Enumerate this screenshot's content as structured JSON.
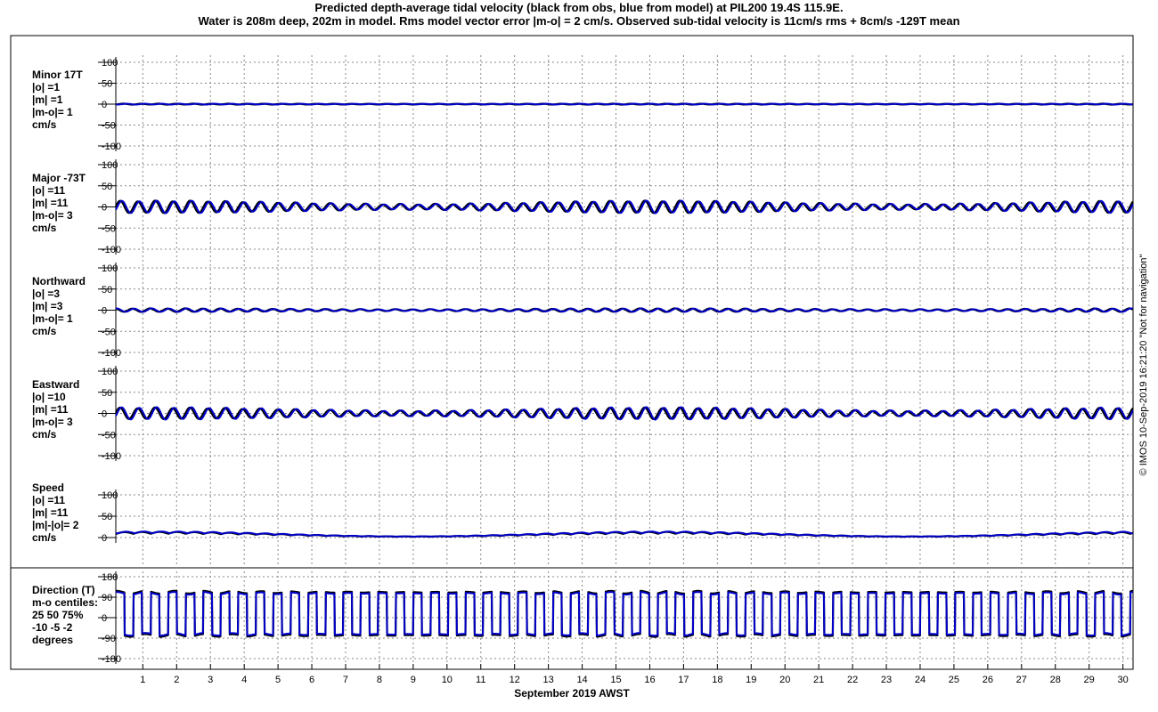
{
  "title": {
    "line1": "Predicted depth-average tidal velocity (black from obs, blue from model) at PIL200 19.4S 115.9E.",
    "line2": "Water is 208m deep, 202m in model. Rms model vector error |m-o| = 2 cm/s. Observed sub-tidal velocity is 11cm/s rms + 8cm/s -129T mean"
  },
  "colors": {
    "obs": "#000000",
    "model": "#0000cc",
    "grid": "#888888"
  },
  "chart_data": {
    "type": "line",
    "xlabel": "September 2019 AWST",
    "xticks": [
      "1",
      "2",
      "3",
      "4",
      "5",
      "6",
      "7",
      "8",
      "9",
      "10",
      "11",
      "12",
      "13",
      "14",
      "15",
      "16",
      "17",
      "18",
      "19",
      "20",
      "21",
      "22",
      "23",
      "24",
      "25",
      "26",
      "27",
      "28",
      "29",
      "30"
    ],
    "xlim_days": [
      0.2,
      30.3
    ],
    "grid": true,
    "footer": "© IMOS 10-Sep-2019 16:21:20  \"Not for navigation\"",
    "panels": [
      {
        "key": "minor",
        "label_lines": [
          "Minor 17T",
          "|o| =1",
          "|m| =1",
          "|m-o|= 1",
          "cm/s"
        ],
        "yticks": [
          "100",
          "50",
          "0",
          "-50",
          "-100"
        ],
        "ylim": [
          -100,
          100
        ],
        "series": [
          {
            "amp": 1,
            "spring": 0.8,
            "phase": 0.3,
            "envelope": 0.3
          },
          {
            "amp": 1,
            "spring": 0.8,
            "phase": 0.4,
            "envelope": 0.3
          }
        ]
      },
      {
        "key": "major",
        "label_lines": [
          "Major -73T",
          "|o| =11",
          "|m| =11",
          "|m-o|= 3",
          "cm/s"
        ],
        "yticks": [
          "100",
          "50",
          "0",
          "-50",
          "-100"
        ],
        "ylim": [
          -100,
          100
        ],
        "series": [
          {
            "amp": 14,
            "spring": 7,
            "phase": 0.2,
            "envelope": 0.55
          },
          {
            "amp": 14,
            "spring": 7,
            "phase": 0.25,
            "envelope": 0.55
          }
        ]
      },
      {
        "key": "north",
        "label_lines": [
          "Northward",
          "|o| =3",
          "|m| =3",
          "|m-o|= 1",
          "cm/s"
        ],
        "yticks": [
          "100",
          "50",
          "0",
          "-50",
          "-100"
        ],
        "ylim": [
          -100,
          100
        ],
        "series": [
          {
            "amp": 4,
            "spring": 2,
            "phase": 1.6,
            "envelope": 0.5
          },
          {
            "amp": 4,
            "spring": 2,
            "phase": 1.65,
            "envelope": 0.5
          }
        ]
      },
      {
        "key": "east",
        "label_lines": [
          "Eastward",
          "|o| =10",
          "|m| =11",
          "|m-o|= 3",
          "cm/s"
        ],
        "yticks": [
          "100",
          "50",
          "0",
          "-50",
          "-100"
        ],
        "ylim": [
          -100,
          100
        ],
        "series": [
          {
            "amp": 13,
            "spring": 7,
            "phase": 3.3,
            "envelope": 0.55
          },
          {
            "amp": 14,
            "spring": 7,
            "phase": 3.35,
            "envelope": 0.55
          }
        ]
      },
      {
        "key": "speed",
        "label_lines": [
          "Speed",
          "|o| =11",
          "|m| =11",
          "|m|-|o|= 2",
          "cm/s"
        ],
        "yticks": [
          "100",
          "50",
          "0"
        ],
        "ylim": [
          0,
          100
        ],
        "series": [
          {
            "base": 9,
            "amp": 7,
            "phase": 0.2
          },
          {
            "base": 10,
            "amp": 7,
            "phase": 0.25
          }
        ]
      },
      {
        "key": "direction",
        "label_lines": [
          "Direction (T)",
          "m-o centiles:",
          "25  50  75%",
          "-10  -5  -2",
          "degrees"
        ],
        "yticks": [
          "180",
          "90",
          "0",
          "-90",
          "-180"
        ],
        "ylim": [
          -180,
          180
        ],
        "series": [
          {
            "high": 107,
            "low": -73
          },
          {
            "high": 107,
            "low": -73
          }
        ]
      }
    ]
  }
}
